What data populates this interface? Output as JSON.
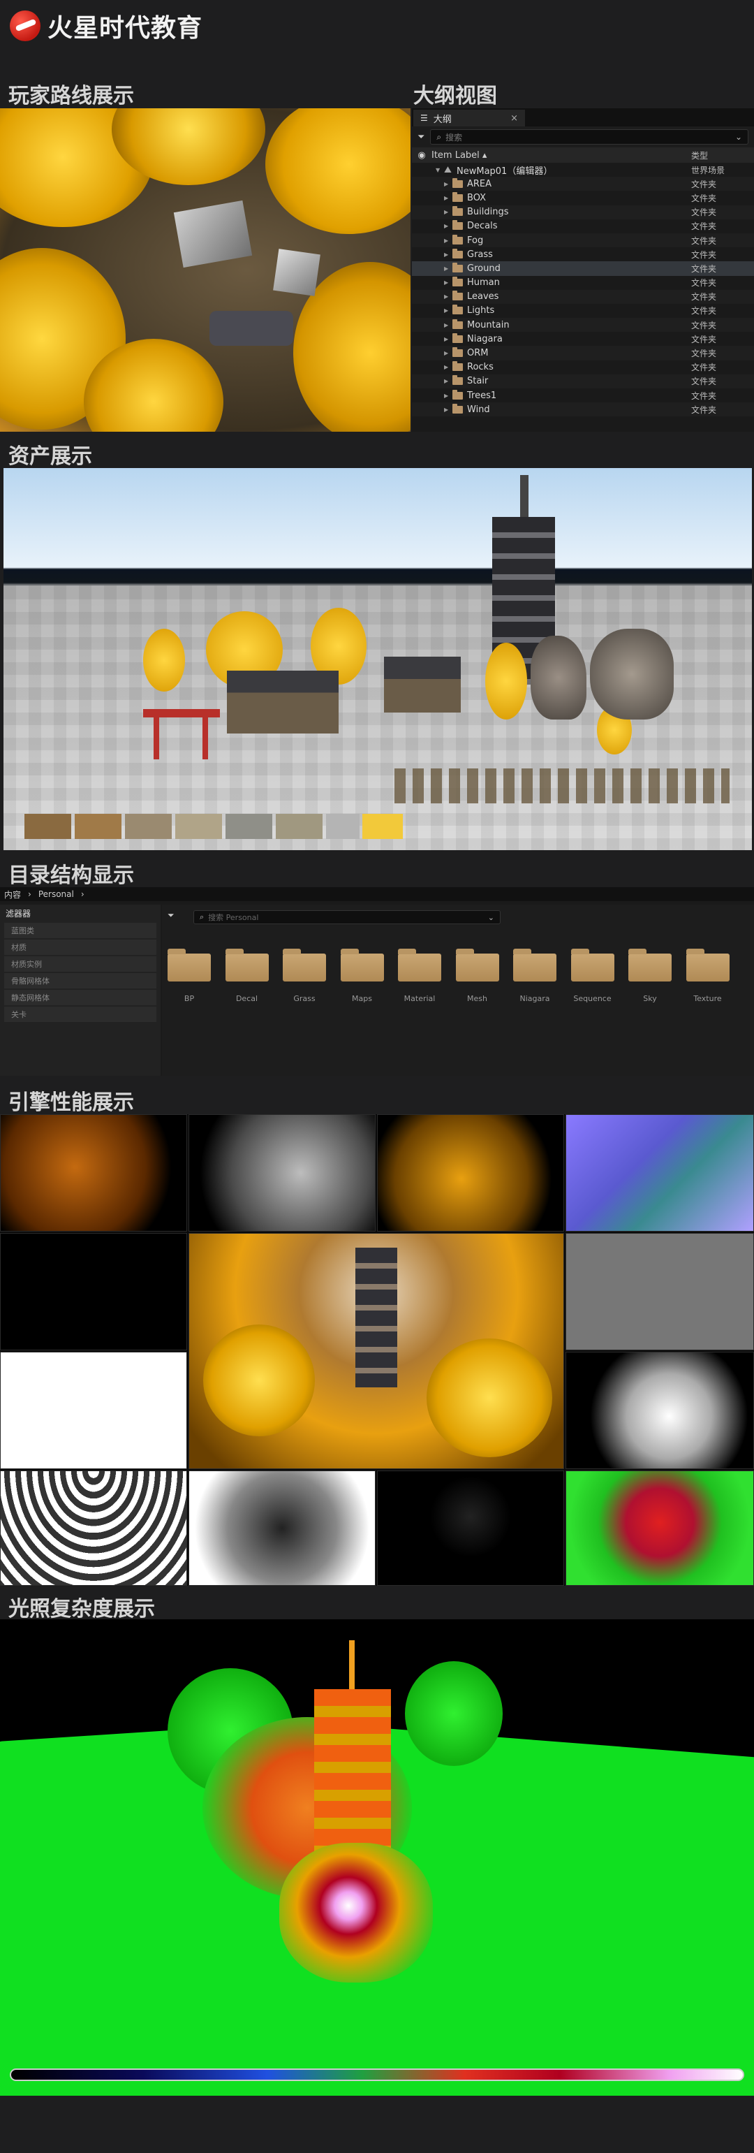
{
  "brand": {
    "name": "火星时代教育"
  },
  "sections": {
    "route": "玩家路线展示",
    "outliner": "大纲视图",
    "assets": "资产展示",
    "directory": "目录结构显示",
    "engine": "引擎性能展示",
    "lighting": "光照复杂度展示"
  },
  "outliner": {
    "tab_label": "大纲",
    "close_glyph": "×",
    "search_placeholder": "搜索",
    "col_label": "Item Label ▴",
    "col_type": "类型",
    "root": {
      "label": "NewMap01（编辑器）",
      "type": "世界场景"
    },
    "items": [
      {
        "label": "AREA",
        "type": "文件夹"
      },
      {
        "label": "BOX",
        "type": "文件夹"
      },
      {
        "label": "Buildings",
        "type": "文件夹"
      },
      {
        "label": "Decals",
        "type": "文件夹"
      },
      {
        "label": "Fog",
        "type": "文件夹"
      },
      {
        "label": "Grass",
        "type": "文件夹"
      },
      {
        "label": "Ground",
        "type": "文件夹"
      },
      {
        "label": "Human",
        "type": "文件夹"
      },
      {
        "label": "Leaves",
        "type": "文件夹"
      },
      {
        "label": "Lights",
        "type": "文件夹"
      },
      {
        "label": "Mountain",
        "type": "文件夹"
      },
      {
        "label": "Niagara",
        "type": "文件夹"
      },
      {
        "label": "ORM",
        "type": "文件夹"
      },
      {
        "label": "Rocks",
        "type": "文件夹"
      },
      {
        "label": "Stair",
        "type": "文件夹"
      },
      {
        "label": "Trees1",
        "type": "文件夹"
      },
      {
        "label": "Wind",
        "type": "文件夹"
      }
    ]
  },
  "content_browser": {
    "breadcrumb": [
      "内容",
      "Personal"
    ],
    "filters_title": "滤器器",
    "filters": [
      "蓝图类",
      "材质",
      "材质实例",
      "骨骼网格体",
      "静态网格体",
      "关卡"
    ],
    "search_placeholder": "搜索 Personal",
    "folders": [
      "BP",
      "Decal",
      "Grass",
      "Maps",
      "Material",
      "Mesh",
      "Niagara",
      "Sequence",
      "Sky",
      "Texture"
    ]
  },
  "colors": {
    "accent_gold": "#f2b70f",
    "folder": "#b8956a",
    "bg": "#1e1e1f"
  }
}
